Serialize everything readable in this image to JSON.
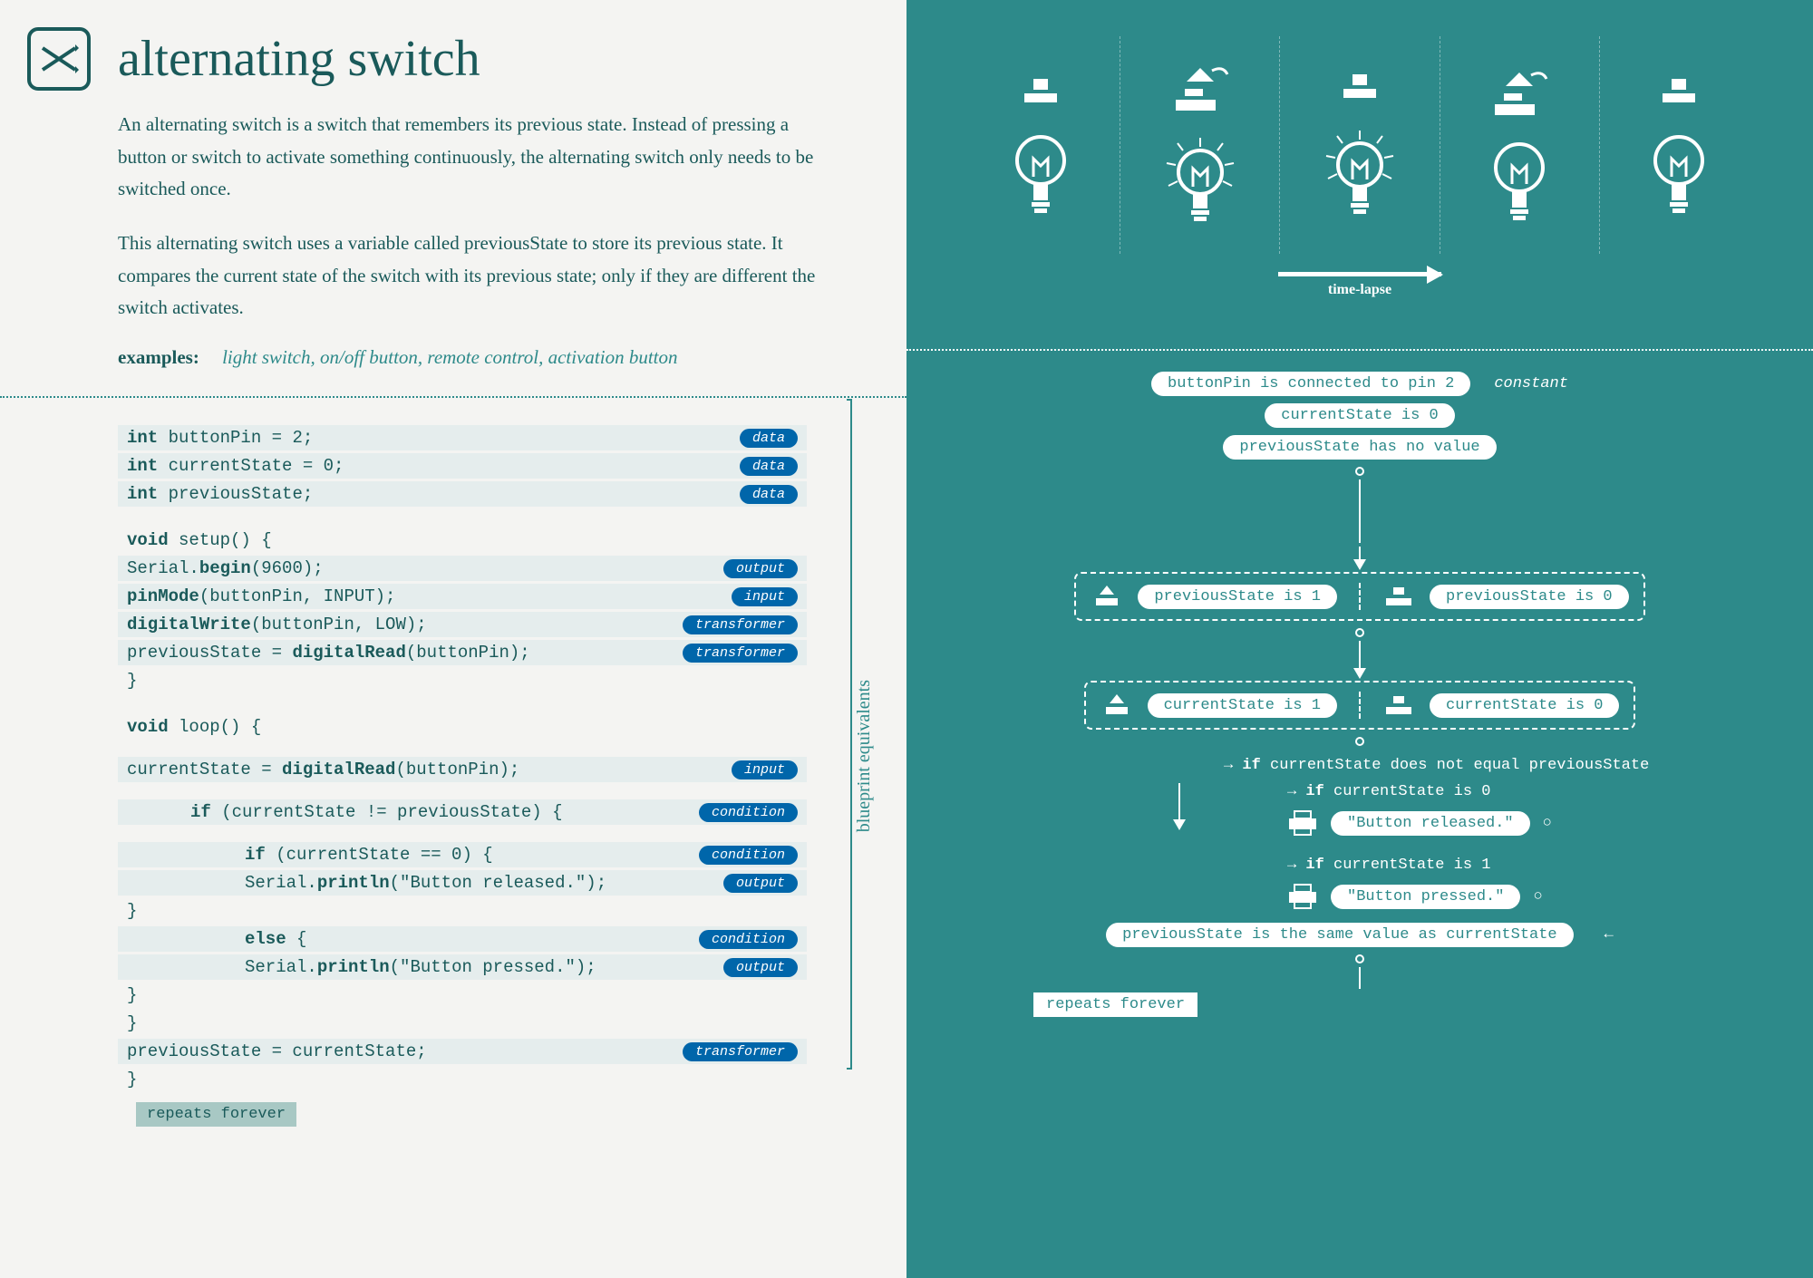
{
  "title": "alternating switch",
  "description_p1": "An alternating switch is a switch that remembers its previous state. Instead of pressing a button or switch to activate something continuously, the alternating switch only needs to be switched once.",
  "description_p2": "This alternating switch uses a variable called previousState to store its previous state. It compares the current state of the switch with its previous state; only if they are different the switch activates.",
  "examples_label": "examples:",
  "examples_text": "light switch, on/off button, remote control, activation button",
  "blueprint_label": "blueprint equivalents",
  "time_lapse": "time-lapse",
  "repeats_forever": "repeats forever",
  "code": {
    "l1": {
      "text_kw": "int",
      "text_rest": " buttonPin = 2;",
      "tag": "data"
    },
    "l2": {
      "text_kw": "int",
      "text_rest": " currentState = 0;",
      "tag": "data"
    },
    "l3": {
      "text_kw": "int",
      "text_rest": " previousState;",
      "tag": "data"
    },
    "l4": {
      "text_kw": "void",
      "text_rest": " setup() {"
    },
    "l5": {
      "text_pre": "  Serial.",
      "text_kw": "begin",
      "text_rest": "(9600);",
      "tag": "output"
    },
    "l6": {
      "text_pre": "  ",
      "text_kw": "pinMode",
      "text_rest": "(buttonPin, INPUT);",
      "tag": "input"
    },
    "l7": {
      "text_pre": "  ",
      "text_kw": "digitalWrite",
      "text_rest": "(buttonPin, LOW);",
      "tag": "transformer"
    },
    "l8": {
      "text_pre": "  previousState = ",
      "text_kw": "digitalRead",
      "text_rest": "(buttonPin);",
      "tag": "transformer"
    },
    "l9": {
      "text": "}"
    },
    "l10": {
      "text_kw": "void",
      "text_rest": " loop() {"
    },
    "l11": {
      "text_pre": "  currentState = ",
      "text_kw": "digitalRead",
      "text_rest": "(buttonPin);",
      "tag": "input"
    },
    "l12": {
      "text_pre": "    ",
      "text_kw": "if",
      "text_rest": " (currentState != previousState) {",
      "tag": "condition"
    },
    "l13": {
      "text_pre": "      ",
      "text_kw": "if",
      "text_rest": " (currentState == 0) {",
      "tag": "condition"
    },
    "l14": {
      "text_pre": "        Serial.",
      "text_kw": "println",
      "text_rest": "(\"Button released.\");",
      "tag": "output"
    },
    "l15": {
      "text": "      }"
    },
    "l16": {
      "text_pre": "      ",
      "text_kw": "else",
      "text_rest": " {",
      "tag": "condition"
    },
    "l17": {
      "text_pre": "        Serial.",
      "text_kw": "println",
      "text_rest": "(\"Button pressed.\");",
      "tag": "output"
    },
    "l18": {
      "text": "      }"
    },
    "l19": {
      "text": "    }"
    },
    "l20": {
      "text": "  previousState = currentState;",
      "tag": "transformer"
    },
    "l21": {
      "text": "}"
    }
  },
  "flow": {
    "n1": "buttonPin is connected to pin 2",
    "n1_label": "constant",
    "n2": "currentState is 0",
    "n3": "previousState has no value",
    "n4a": "previousState is 1",
    "n4b": "previousState is 0",
    "n5a": "currentState is 1",
    "n5b": "currentState is 0",
    "n6_pre": "if",
    "n6": " currentState does not equal previousState",
    "n7_pre": "if",
    "n7": " currentState is 0",
    "n8": "\"Button released.\"",
    "n9_pre": "if",
    "n9": " currentState is 1",
    "n10": "\"Button pressed.\"",
    "n11": "previousState is the same value as currentState"
  }
}
